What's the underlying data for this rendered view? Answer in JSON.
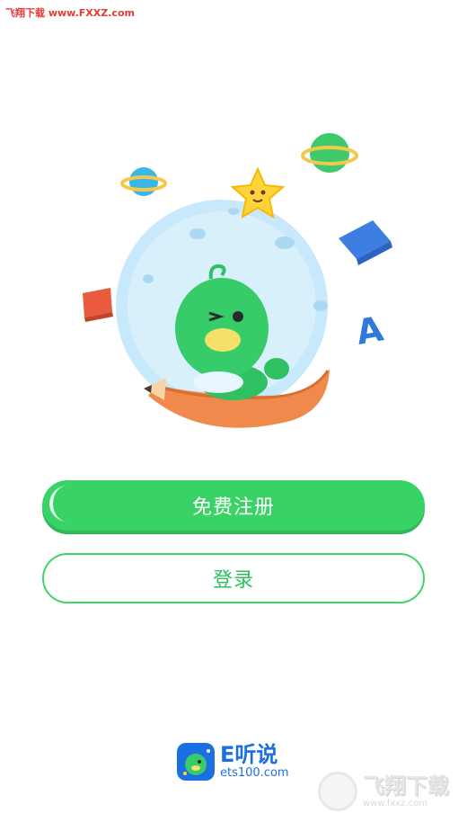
{
  "watermark_top": {
    "text": "飞翔下载 www.FXXZ.com"
  },
  "buttons": {
    "register_label": "免费注册",
    "login_label": "登录"
  },
  "brand": {
    "name": "E听说",
    "url": "ets100.com"
  },
  "watermark_bottom": {
    "name": "飞翔下载",
    "url": "www.fxxz.com"
  },
  "colors": {
    "primary_green": "#39d365",
    "brand_blue": "#1c6fe0",
    "watermark_red": "#e53935"
  }
}
